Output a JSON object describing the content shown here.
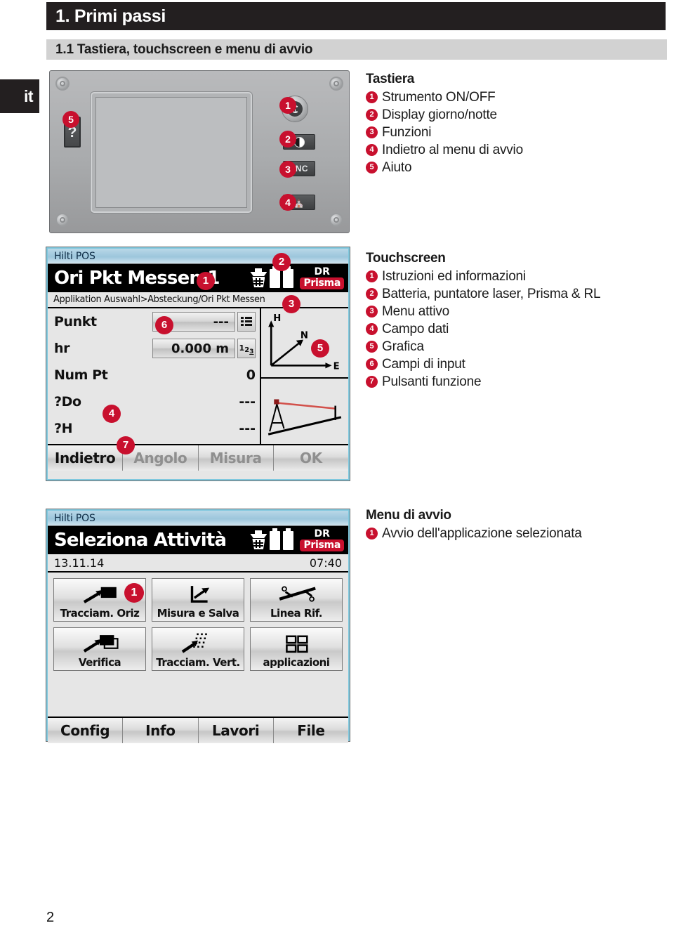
{
  "page": {
    "language_tab": "it",
    "page_number": "2",
    "chapter_title": "1. Primi passi",
    "section_title": "1.1 Tastiera, touchscreen e menu di avvio",
    "accent_red": "#c8102e",
    "header_black": "#231f20",
    "section_gray": "#d2d2d2"
  },
  "keyboard_figure": {
    "callouts": [
      "1",
      "2",
      "3",
      "4",
      "5"
    ],
    "keys": {
      "power": "power-button",
      "day_night": "day-night-display-button",
      "fnc": "FNC",
      "home": "home-button",
      "help": "?"
    }
  },
  "keyboard_legend": {
    "title": "Tastiera",
    "items": [
      {
        "num": "1",
        "label": "Strumento ON/OFF"
      },
      {
        "num": "2",
        "label": "Display giorno/notte"
      },
      {
        "num": "3",
        "label": "Funzioni"
      },
      {
        "num": "4",
        "label": "Indietro al menu di avvio"
      },
      {
        "num": "5",
        "label": "Aiuto"
      }
    ]
  },
  "touchscreen_legend": {
    "title": "Touchscreen",
    "items": [
      {
        "num": "1",
        "label": "Istruzioni ed informazioni"
      },
      {
        "num": "2",
        "label": "Batteria, puntatore laser, Prisma & RL"
      },
      {
        "num": "3",
        "label": "Menu attivo"
      },
      {
        "num": "4",
        "label": "Campo dati"
      },
      {
        "num": "5",
        "label": "Grafica"
      },
      {
        "num": "6",
        "label": "Campi di input"
      },
      {
        "num": "7",
        "label": "Pulsanti funzione"
      }
    ]
  },
  "startmenu_legend": {
    "title": "Menu di avvio",
    "items": [
      {
        "num": "1",
        "label": "Avvio dell'applicazione selezionata"
      }
    ]
  },
  "measure_screen": {
    "app_name": "Hilti POS",
    "header_title": "Ori Pkt Messen 1",
    "status": {
      "mode": "DR",
      "target": "Prisma"
    },
    "breadcrumb": "Applikation Auswahl>Absteckung/Ori Pkt Messen",
    "rows": [
      {
        "label": "Punkt",
        "value": "---",
        "type": "input",
        "adorn": "list-icon"
      },
      {
        "label": "hr",
        "value": "0.000 m",
        "type": "input",
        "adorn": "123"
      },
      {
        "label": "Num Pt",
        "value": "0",
        "type": "static"
      },
      {
        "label": "?Do",
        "value": "---",
        "type": "static"
      },
      {
        "label": "?H",
        "value": "---",
        "type": "static"
      }
    ],
    "graphics": {
      "axes": [
        "H",
        "N",
        "E"
      ],
      "second_cell": "tripod-laser-slope-diagram"
    },
    "softkeys": [
      {
        "label": "Indietro",
        "state": "active"
      },
      {
        "label": "Angolo",
        "state": "dim"
      },
      {
        "label": "Misura",
        "state": "dim"
      },
      {
        "label": "OK",
        "state": "dim"
      }
    ],
    "callouts": [
      "1",
      "2",
      "3",
      "4",
      "5",
      "6",
      "7"
    ]
  },
  "start_screen": {
    "app_name": "Hilti POS",
    "header_title": "Seleziona Attività",
    "status": {
      "mode": "DR",
      "target": "Prisma"
    },
    "date": "13.11.14",
    "time": "07:40",
    "tiles": [
      [
        {
          "label": "Tracciam. Oriz",
          "icon": "arrow-to-square-icon"
        },
        {
          "label": "Misura e Salva",
          "icon": "axis-arrow-icon"
        },
        {
          "label": "Linea Rif.",
          "icon": "reference-line-icon"
        }
      ],
      [
        {
          "label": "Verifica",
          "icon": "arrow-to-outline-square-icon"
        },
        {
          "label": "Tracciam. Vert.",
          "icon": "arrow-to-dot-grid-icon"
        },
        {
          "label": "applicazioni",
          "icon": "four-squares-icon"
        }
      ]
    ],
    "softkeys": [
      {
        "label": "Config",
        "state": "active"
      },
      {
        "label": "Info",
        "state": "active"
      },
      {
        "label": "Lavori",
        "state": "active"
      },
      {
        "label": "File",
        "state": "active"
      }
    ],
    "callouts": [
      "1"
    ]
  }
}
